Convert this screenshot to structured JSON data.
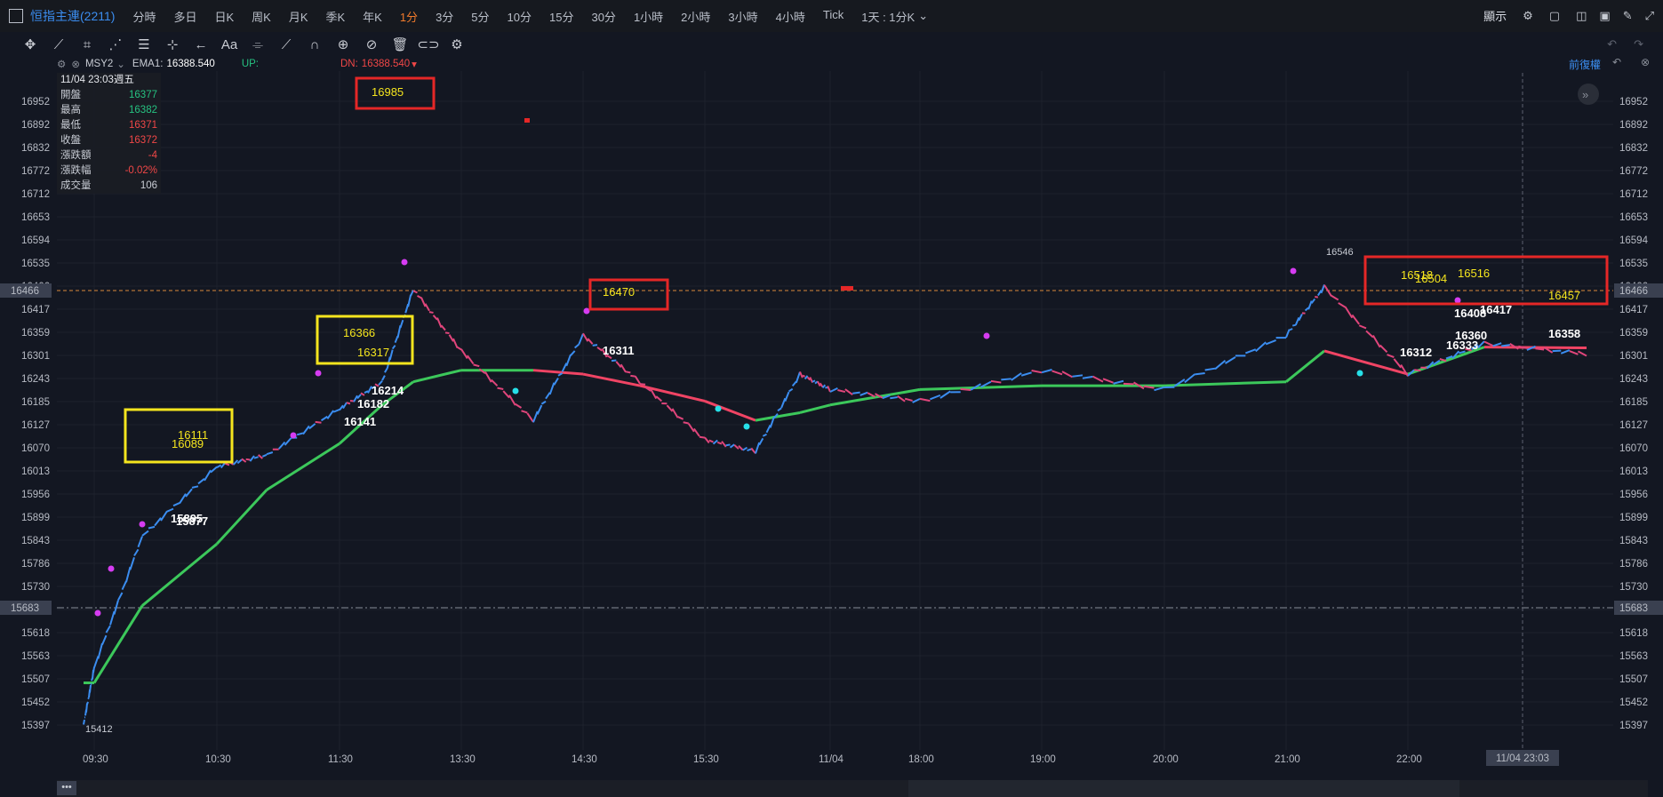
{
  "header": {
    "symbol": "恒指主連(2211)",
    "timeframes": [
      "分時",
      "多日",
      "日K",
      "周K",
      "月K",
      "季K",
      "年K",
      "1分",
      "3分",
      "5分",
      "10分",
      "15分",
      "30分",
      "1小時",
      "2小時",
      "3小時",
      "4小時",
      "Tick"
    ],
    "active_timeframe": "1分",
    "range_selector": "1天 : 1分K",
    "display_menu": "顯示"
  },
  "legend": {
    "msy2": "MSY2",
    "ema_label": "EMA1:",
    "ema_value": "16388.540",
    "up_label": "UP:",
    "dn_label": "DN:",
    "dn_value": "16388.540",
    "right_label": "前復權"
  },
  "info": {
    "datetime": "11/04 23:03週五",
    "rows": [
      {
        "label": "開盤",
        "value": "16377",
        "color": "#26c281"
      },
      {
        "label": "最高",
        "value": "16382",
        "color": "#26c281"
      },
      {
        "label": "最低",
        "value": "16371",
        "color": "#f04747"
      },
      {
        "label": "收盤",
        "value": "16372",
        "color": "#f04747"
      },
      {
        "label": "漲跌額",
        "value": "-4",
        "color": "#f04747"
      },
      {
        "label": "漲跌幅",
        "value": "-0.02%",
        "color": "#f04747"
      },
      {
        "label": "成交量",
        "value": "106",
        "color": "#c8ccd4"
      }
    ]
  },
  "y_axis": {
    "labels": [
      "16952",
      "16892",
      "16832",
      "16772",
      "16712",
      "16653",
      "16594",
      "16535",
      "16466",
      "16417",
      "16359",
      "16301",
      "16243",
      "16185",
      "16127",
      "16070",
      "16013",
      "15956",
      "15899",
      "15843",
      "15786",
      "15730",
      "15683",
      "15618",
      "15563",
      "15507",
      "15452",
      "15397"
    ],
    "highlight_upper": "16466",
    "highlight_lower": "15683"
  },
  "x_axis": {
    "labels": [
      "09:30",
      "10:30",
      "11:30",
      "13:30",
      "14:30",
      "15:30",
      "11/04",
      "18:00",
      "19:00",
      "20:00",
      "21:00",
      "22:00"
    ],
    "cursor_label": "11/04 23:03"
  },
  "chart_data": {
    "type": "line",
    "x": [
      "09:15",
      "09:30",
      "10:00",
      "10:30",
      "11:00",
      "11:30",
      "11:45",
      "12:00",
      "13:30",
      "14:00",
      "14:30",
      "15:00",
      "15:30",
      "16:00",
      "16:30",
      "17:15",
      "18:00",
      "19:00",
      "20:00",
      "21:00",
      "21:30",
      "22:00",
      "22:30",
      "23:00"
    ],
    "ylim": [
      15380,
      16990
    ],
    "series": [
      {
        "name": "Price",
        "values": [
          15412,
          15560,
          15900,
          16080,
          16110,
          16230,
          16300,
          16540,
          16380,
          16200,
          16420,
          16300,
          16150,
          16120,
          16320,
          16280,
          16250,
          16330,
          16280,
          16420,
          16546,
          16320,
          16400,
          16372
        ]
      },
      {
        "name": "EMA",
        "values": [
          15520,
          15520,
          15720,
          15880,
          16020,
          16140,
          16240,
          16300,
          16330,
          16330,
          16320,
          16290,
          16250,
          16200,
          16220,
          16240,
          16280,
          16290,
          16290,
          16300,
          16380,
          16320,
          16390,
          16388
        ]
      }
    ],
    "annotations": [
      "15412",
      "15895",
      "15877",
      "16089",
      "16111",
      "16141",
      "16182",
      "16214",
      "16317",
      "16366",
      "16470",
      "16311",
      "16546",
      "16985",
      "16516",
      "16518",
      "16504",
      "16457",
      "16417",
      "16408",
      "16358",
      "16360",
      "16333",
      "16312"
    ]
  },
  "boxes": {
    "yellow1a": "16111",
    "yellow1b": "16089",
    "yellow2a": "16366",
    "yellow2b": "16317",
    "red1": "16985",
    "red2": "16470",
    "red3a": "16518",
    "red3b": "16504",
    "red3c": "16516",
    "red3d": "16457"
  },
  "colors": {
    "bg": "#131722",
    "price": "#3b8df0",
    "ema_up": "#3cc85b",
    "ema_down": "#f04464",
    "accent": "#f07a2b"
  }
}
